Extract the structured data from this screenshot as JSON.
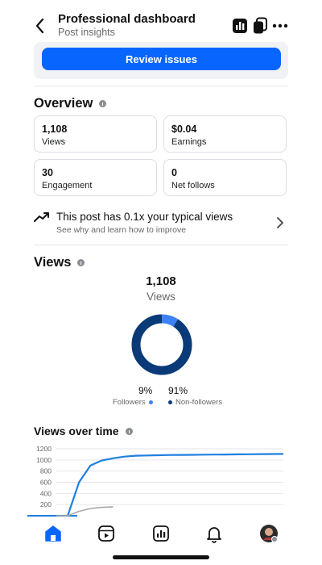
{
  "header": {
    "title": "Professional dashboard",
    "subtitle": "Post insights"
  },
  "review": {
    "button_label": "Review issues"
  },
  "overview": {
    "title": "Overview",
    "stats": [
      {
        "value": "1,108",
        "label": "Views"
      },
      {
        "value": "$0.04",
        "label": "Earnings"
      },
      {
        "value": "30",
        "label": "Engagement"
      },
      {
        "value": "0",
        "label": "Net follows"
      }
    ]
  },
  "insight": {
    "text": "This post has 0.1x your typical views",
    "subtext": "See why and learn how to improve"
  },
  "views": {
    "title": "Views",
    "total": "1,108",
    "total_label": "Views",
    "followers_pct": "9%",
    "followers_label": "Followers",
    "nonfollowers_pct": "91%",
    "nonfollowers_label": "Non-followers"
  },
  "views_over_time": {
    "title": "Views over time"
  },
  "chart_data": {
    "type": "donut",
    "slices": [
      {
        "name": "Followers",
        "value": 9,
        "color": "#3b82f6"
      },
      {
        "name": "Non-followers",
        "value": 91,
        "color": "#0a3b78"
      }
    ],
    "line_chart": {
      "type": "line",
      "y_ticks": [
        "1200",
        "1000",
        "800",
        "600",
        "400",
        "200"
      ],
      "ylim": [
        0,
        1200
      ],
      "series": [
        {
          "color": "#1f7fe0",
          "values": [
            0,
            0,
            600,
            900,
            990,
            1030,
            1060,
            1075,
            1080,
            1085,
            1088,
            1090,
            1092,
            1094,
            1096,
            1098,
            1100,
            1102,
            1104,
            1106,
            1108
          ]
        },
        {
          "color": "#a8a8a8",
          "values": [
            0,
            0,
            80,
            130,
            150,
            160
          ]
        }
      ]
    }
  },
  "colors": {
    "accent": "#0866ff",
    "donut_followers": "#3b82f6",
    "donut_nonfollowers": "#0a3b78"
  },
  "icons": {
    "back": "chevron-left-icon",
    "insights": "bar-chart-icon",
    "copy": "copy-icon",
    "more": "more-horizontal-icon",
    "trend": "trending-up-icon",
    "home": "home-icon",
    "reels": "reels-icon",
    "dashboard": "dashboard-icon",
    "notifications": "bell-icon",
    "profile": "avatar"
  }
}
